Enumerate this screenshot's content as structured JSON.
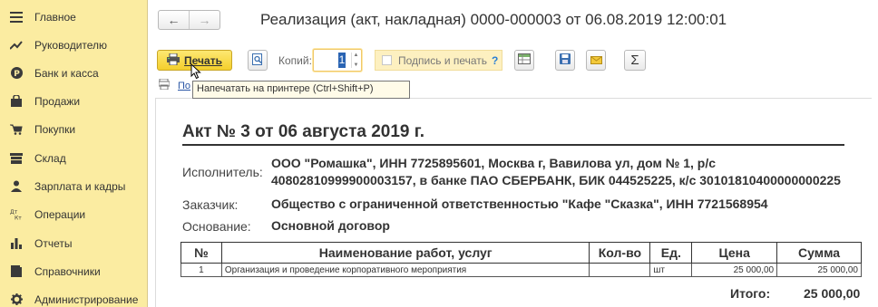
{
  "sidebar": {
    "items": [
      {
        "label": "Главное",
        "icon": "menu-icon"
      },
      {
        "label": "Руководителю",
        "icon": "trend-icon"
      },
      {
        "label": "Банк и касса",
        "icon": "ruble-icon"
      },
      {
        "label": "Продажи",
        "icon": "bag-icon"
      },
      {
        "label": "Покупки",
        "icon": "cart-icon"
      },
      {
        "label": "Склад",
        "icon": "warehouse-icon"
      },
      {
        "label": "Зарплата и кадры",
        "icon": "person-icon"
      },
      {
        "label": "Операции",
        "icon": "dtkt-icon"
      },
      {
        "label": "Отчеты",
        "icon": "bar-chart-icon"
      },
      {
        "label": "Справочники",
        "icon": "book-icon"
      },
      {
        "label": "Администрирование",
        "icon": "gear-icon"
      }
    ]
  },
  "header": {
    "title": "Реализация (акт, накладная) 0000-000003 от 06.08.2019 12:00:01"
  },
  "toolbar": {
    "print_label": "Печать",
    "copies_label": "Копий:",
    "copies_value": "1",
    "sign_print_label": "Подпись и печать",
    "help_mark": "?"
  },
  "link_partial": "По",
  "tooltip": "Напечатать на принтере (Ctrl+Shift+P)",
  "document": {
    "heading": "Акт № 3 от 06 августа 2019 г.",
    "executor_label": "Исполнитель:",
    "executor_line1": "ООО \"Ромашка\", ИНН 7725895601, Москва г, Вавилова ул, дом № 1, р/с",
    "executor_line2": "40802810999900003157, в банке ПАО СБЕРБАНК, БИК 044525225, к/с 30101810400000000225",
    "customer_label": "Заказчик:",
    "customer_value": "Общество с ограниченной ответственностью \"Кафе \"Сказка\", ИНН 7721568954",
    "basis_label": "Основание:",
    "basis_value": "Основной договор",
    "table": {
      "headers": [
        "№",
        "Наименование работ, услуг",
        "Кол-во",
        "Ед.",
        "Цена",
        "Сумма"
      ],
      "rows": [
        [
          "1",
          "Организация и проведение корпоративного мероприятия",
          "",
          "шт",
          "25 000,00",
          "25 000,00"
        ]
      ]
    },
    "total_label": "Итого:",
    "total_value": "25 000,00"
  },
  "colors": {
    "sidebar_bg": "#fbeca1",
    "print_button": "#f4cf2c",
    "tooltip_bg": "#fffbe8"
  }
}
